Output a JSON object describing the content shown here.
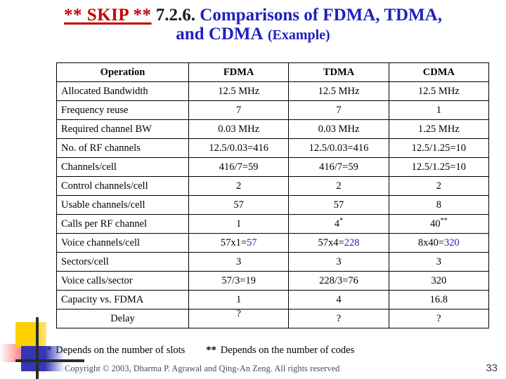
{
  "slide": {
    "title": {
      "skip_marker": "** SKIP **",
      "section_number": "7.2.6.",
      "main_line1": "Comparisons of FDMA, TDMA,",
      "main_line2": "and CDMA",
      "example_suffix": "(Example)"
    },
    "colors": {
      "skip_red": "#C00000",
      "title_blue": "#2020C0",
      "text_black": "#000000",
      "copyright_gray": "#4a4a63"
    }
  },
  "table": {
    "headers": [
      "Operation",
      "FDMA",
      "TDMA",
      "CDMA"
    ],
    "rows": [
      {
        "label": "Allocated Bandwidth",
        "fdma": "12.5 MHz",
        "tdma": "12.5 MHz",
        "cdma": "12.5 MHz"
      },
      {
        "label": "Frequency reuse",
        "fdma": "7",
        "tdma": "7",
        "cdma": "1"
      },
      {
        "label": "Required channel BW",
        "fdma": "0.03 MHz",
        "tdma": "0.03 MHz",
        "cdma": "1.25 MHz"
      },
      {
        "label": "No. of RF channels",
        "fdma": "12.5/0.03=416",
        "tdma": "12.5/0.03=416",
        "cdma": "12.5/1.25=10"
      },
      {
        "label": "Channels/cell",
        "fdma": "416/7=59",
        "tdma": "416/7=59",
        "cdma": "12.5/1.25=10"
      },
      {
        "label": "Control channels/cell",
        "fdma": "2",
        "tdma": "2",
        "cdma": "2"
      },
      {
        "label": "Usable channels/cell",
        "fdma": "57",
        "tdma": "57",
        "cdma": "8"
      },
      {
        "label": "Calls per RF channel",
        "fdma": "1",
        "tdma_base": "4",
        "tdma_sup": "*",
        "cdma_base": "40",
        "cdma_sup": "**"
      },
      {
        "label": "Voice channels/cell",
        "fdma_expr": "57x1=",
        "fdma_result": "57",
        "tdma_expr": "57x4=",
        "tdma_result": "228",
        "cdma_expr": "8x40=",
        "cdma_result": "320"
      },
      {
        "label": "Sectors/cell",
        "fdma": "3",
        "tdma": "3",
        "cdma": "3"
      },
      {
        "label": "Voice calls/sector",
        "fdma": "57/3=19",
        "tdma": "228/3=76",
        "cdma": "320"
      },
      {
        "label": "Capacity vs. FDMA",
        "fdma": "1",
        "tdma": "4",
        "cdma": "16.8"
      },
      {
        "label": "Delay",
        "fdma": "?",
        "tdma": "?",
        "cdma": "?"
      }
    ]
  },
  "footnotes": {
    "mark1": "*",
    "text1": "Depends on the number of slots",
    "mark2": "**",
    "text2": "Depends on the number of codes"
  },
  "footer": {
    "copyright": "Copyright © 2003, Dharma P. Agrawal and Qing-An Zeng. All rights reserved",
    "page_number": "33"
  }
}
